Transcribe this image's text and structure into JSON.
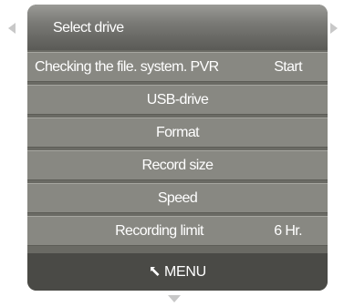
{
  "header": {
    "title": "Select drive"
  },
  "menu": {
    "items": [
      {
        "label": "Checking the file. system. PVR",
        "value": "Start"
      },
      {
        "label": "USB-drive",
        "value": ""
      },
      {
        "label": "Format",
        "value": ""
      },
      {
        "label": "Record size",
        "value": ""
      },
      {
        "label": "Speed",
        "value": ""
      },
      {
        "label": "Recording limit",
        "value": "6 Hr."
      }
    ]
  },
  "footer": {
    "label": "MENU",
    "icon": "return-icon"
  },
  "nav": {
    "left": "left-arrow-icon",
    "right": "right-arrow-icon",
    "down": "down-arrow-icon"
  },
  "colors": {
    "panel": "#6a6a64",
    "row": "#888882",
    "footer": "#4a4a46",
    "text": "#ffffff",
    "arrows": "#c8c8c8"
  }
}
